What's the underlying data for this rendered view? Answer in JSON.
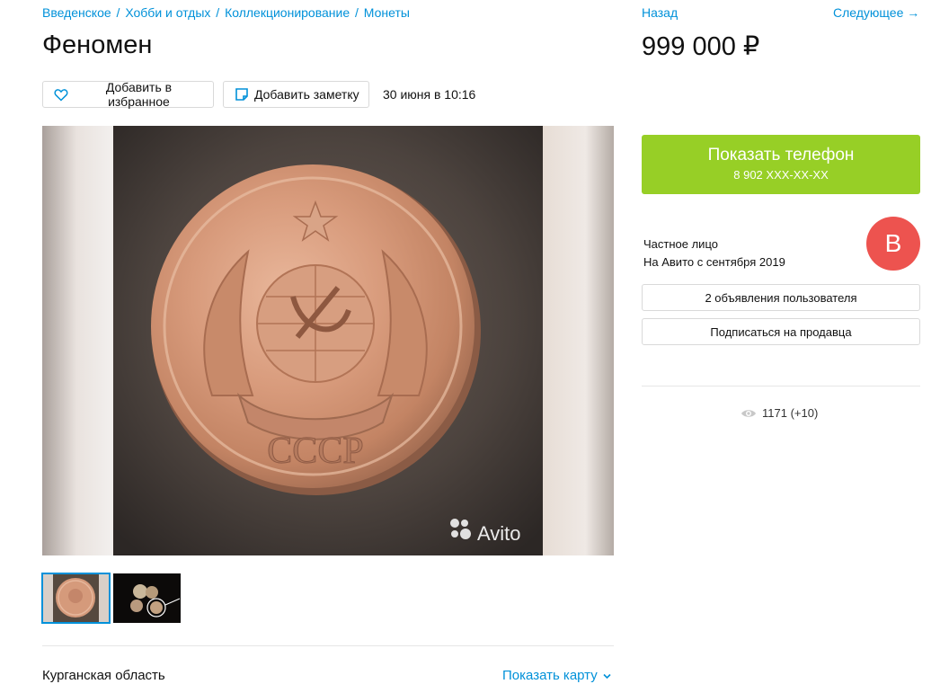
{
  "breadcrumbs": [
    "Введенское",
    "Хобби и отдых",
    "Коллекционирование",
    "Монеты"
  ],
  "breadcrumb_separator": "/",
  "title": "Феномен",
  "actions": {
    "favorite_label": "Добавить в избранное",
    "note_label": "Добавить заметку",
    "date": "30 июня в 10:16"
  },
  "gallery": {
    "watermark": "Avito",
    "coin_inscription": "СССР"
  },
  "location": {
    "region": "Курганская область",
    "map_link": "Показать карту"
  },
  "nav": {
    "back": "Назад",
    "next": "Следующее →"
  },
  "price": "999 000 ₽",
  "phone_button": {
    "label": "Показать телефон",
    "number": "8 902 XXX-XX-XX"
  },
  "seller": {
    "type": "Частное лицо",
    "since": "На Авито с сентября 2019",
    "avatar_letter": "В",
    "ads_button": "2 объявления пользователя",
    "subscribe_button": "Подписаться на продавца"
  },
  "views": "1171 (+10)",
  "colors": {
    "link": "#0091d9",
    "phone_button": "#97cf26",
    "avatar": "#ed534f"
  },
  "icons": [
    "heart-icon",
    "note-icon",
    "eye-icon",
    "chevron-down-icon"
  ]
}
